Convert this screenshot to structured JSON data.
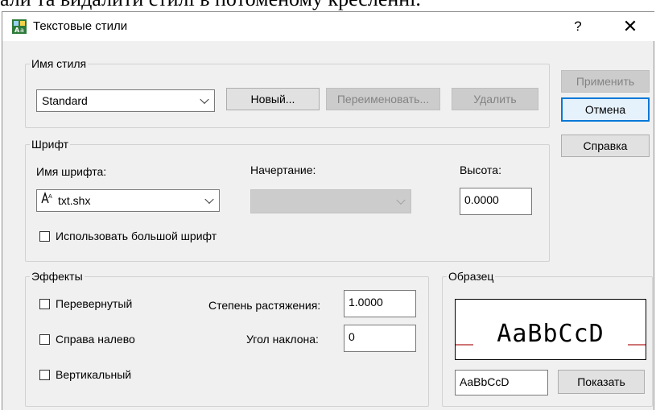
{
  "background_text": "али та видалити стилі в потоменому кресленні.",
  "window": {
    "title": "Текстовые стили",
    "help_label": "?",
    "close_label": "✕"
  },
  "style_name_group": {
    "label": "Имя стиля",
    "selected": "Standard",
    "new_button": "Новый...",
    "rename_button": "Переименовать...",
    "delete_button": "Удалить"
  },
  "side_buttons": {
    "apply": "Применить",
    "cancel": "Отмена",
    "help": "Справка"
  },
  "font_group": {
    "label": "Шрифт",
    "font_name_label": "Имя шрифта:",
    "font_name_value": "txt.shx",
    "style_label": "Начертание:",
    "style_value": "",
    "height_label": "Высота:",
    "height_value": "0.0000",
    "bigfont_label": "Использовать большой шрифт"
  },
  "effects_group": {
    "label": "Эффекты",
    "upside_down": "Перевернутый",
    "backwards": "Справа налево",
    "vertical": "Вертикальный",
    "width_factor_label": "Степень растяжения:",
    "width_factor_value": "1.0000",
    "oblique_label": "Угол наклона:",
    "oblique_value": "0"
  },
  "preview_group": {
    "label": "Образец",
    "preview_text": "AaBbCcD",
    "sample_input": "AaBbCcD",
    "show_button": "Показать"
  },
  "colors": {
    "accent": "#0078d7",
    "preview_line": "#b02020"
  }
}
